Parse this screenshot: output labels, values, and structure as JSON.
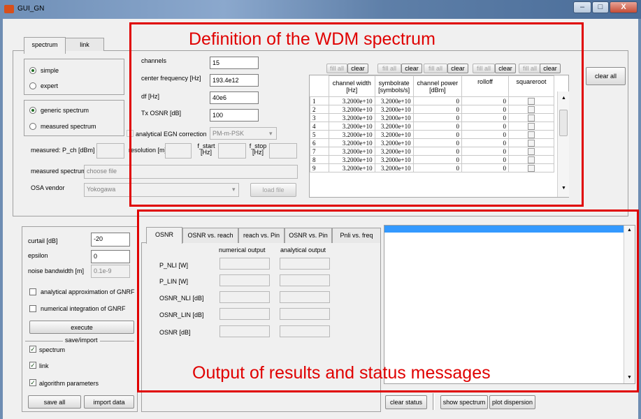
{
  "window": {
    "title": "GUI_GN",
    "min": "–",
    "max": "□",
    "close": "X"
  },
  "top_tabs": [
    "spectrum",
    "link"
  ],
  "mode": {
    "simple": "simple",
    "expert": "expert",
    "selected": "simple"
  },
  "spectrum_type": {
    "generic": "generic spectrum",
    "measured": "measured spectrum",
    "selected": "generic"
  },
  "params": {
    "channels_label": "channels",
    "channels_value": "15",
    "center_freq_label": "center frequency [Hz]",
    "center_freq_value": "193.4e12",
    "df_label": "df [Hz]",
    "df_value": "40e6",
    "tx_osnr_label": "Tx OSNR [dB]",
    "tx_osnr_value": "100"
  },
  "egn": {
    "label": "analytical EGN correction",
    "value": "PM-m-PSK"
  },
  "measured": {
    "pch_label": "measured: P_ch [dBm]",
    "resolution_label": "resolution [m]",
    "fstart_label": "f_start [Hz]",
    "fstop_label": "f_stop [Hz]",
    "spectrum_label": "measured spectrum",
    "spectrum_placeholder": "choose file",
    "osa_label": "OSA vendor",
    "osa_value": "Yokogawa",
    "load_button": "load file"
  },
  "table": {
    "fill_all": "fill all",
    "clear": "clear",
    "headers": [
      [
        "channel width",
        "[Hz]"
      ],
      [
        "symbolrate",
        "[symbols/s]"
      ],
      [
        "channel power",
        "[dBm]"
      ],
      [
        "rolloff",
        ""
      ],
      [
        "squareroot",
        ""
      ]
    ],
    "rows": [
      [
        "1",
        "3.2000e+10",
        "3.2000e+10",
        "0",
        "0"
      ],
      [
        "2",
        "3.2000e+10",
        "3.2000e+10",
        "0",
        "0"
      ],
      [
        "3",
        "3.2000e+10",
        "3.2000e+10",
        "0",
        "0"
      ],
      [
        "4",
        "3.2000e+10",
        "3.2000e+10",
        "0",
        "0"
      ],
      [
        "5",
        "3.2000e+10",
        "3.2000e+10",
        "0",
        "0"
      ],
      [
        "6",
        "3.2000e+10",
        "3.2000e+10",
        "0",
        "0"
      ],
      [
        "7",
        "3.2000e+10",
        "3.2000e+10",
        "0",
        "0"
      ],
      [
        "8",
        "3.2000e+10",
        "3.2000e+10",
        "0",
        "0"
      ],
      [
        "9",
        "3.2000e+10",
        "3.2000e+10",
        "0",
        "0"
      ]
    ]
  },
  "clear_all": "clear all",
  "algo": {
    "curtail_label": "curtail [dB]",
    "curtail_value": "-20",
    "epsilon_label": "epsilon",
    "epsilon_value": "0",
    "noise_bw_label": "noise bandwidth [m]",
    "noise_bw_value": "0.1e-9",
    "approx_label": "analytical approximation of GNRF",
    "numint_label": "numerical integration of GNRF",
    "execute": "execute",
    "save_import": "save/import",
    "chk_spectrum": "spectrum",
    "chk_link": "link",
    "chk_algo": "algorithm parameters",
    "save_all": "save all",
    "import_data": "import data"
  },
  "output_tabs": [
    "OSNR",
    "OSNR vs. reach",
    "reach vs. Pin",
    "OSNR vs. Pin",
    "Pnli vs. freq"
  ],
  "output": {
    "numerical": "numerical output",
    "analytical": "analytical output",
    "rows": [
      "P_NLI [W]",
      "P_LIN [W]",
      "OSNR_NLI [dB]",
      "OSNR_LIN [dB]",
      "OSNR [dB]"
    ]
  },
  "status_buttons": {
    "clear_status": "clear status",
    "show_spectrum": "show spectrum",
    "plot_dispersion": "plot dispersion"
  },
  "annotations": {
    "top": "Definition of the WDM spectrum",
    "bottom": "Output of results and status messages",
    "color": "#e00000"
  }
}
